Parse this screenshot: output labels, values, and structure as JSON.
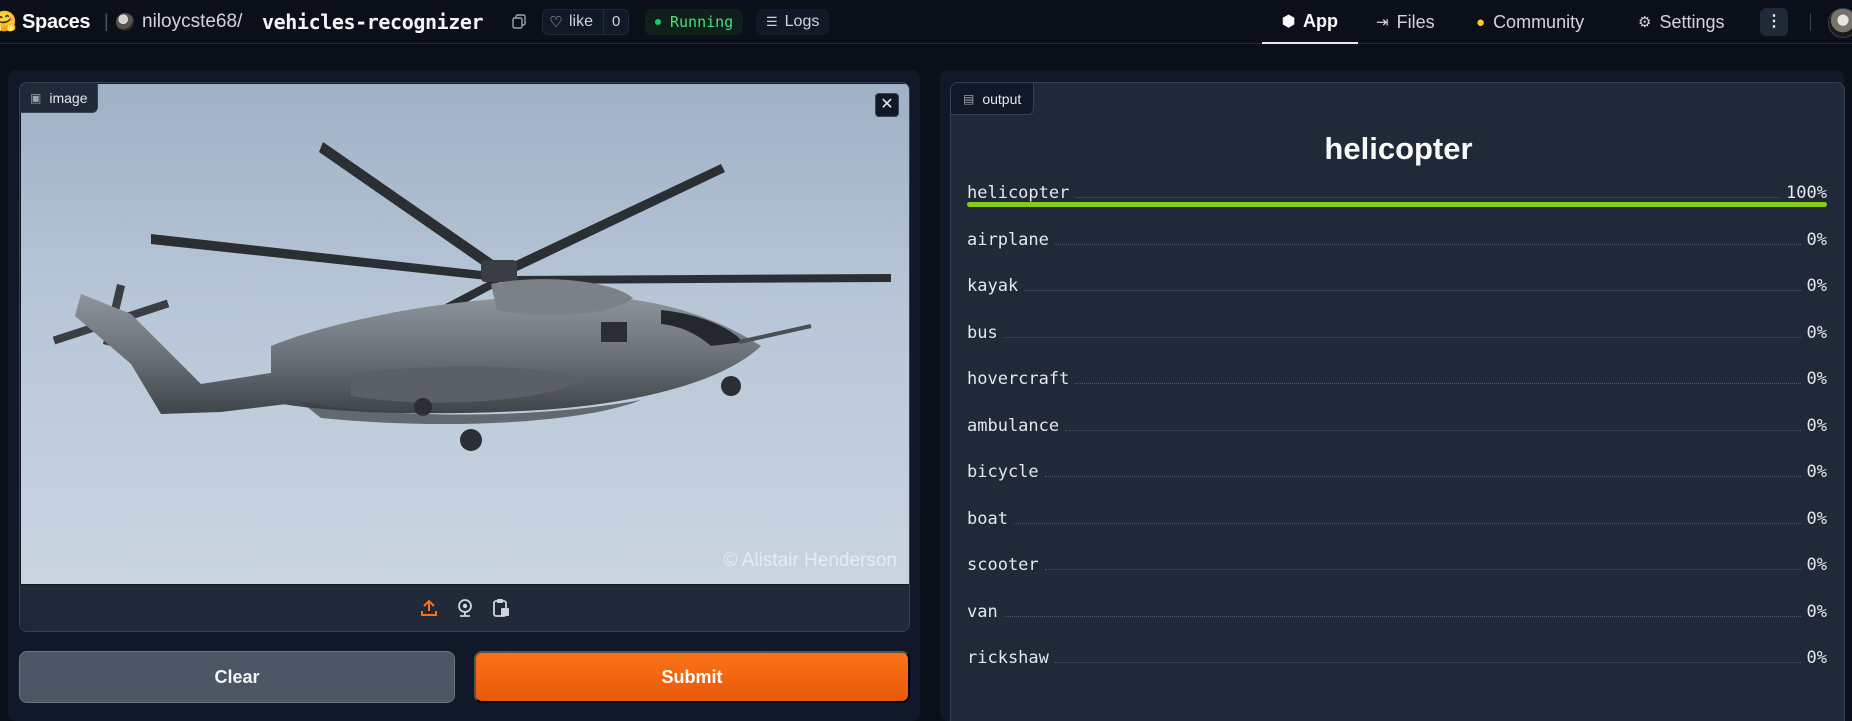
{
  "header": {
    "logo_emoji": "🤗",
    "brand": "Spaces",
    "owner": "niloycste68",
    "slash": "/",
    "repo": "vehicles-recognizer",
    "like_label": "like",
    "like_count": "0",
    "status": "Running",
    "logs_label": "Logs",
    "nav": {
      "app": "App",
      "files": "Files",
      "community": "Community",
      "settings": "Settings"
    }
  },
  "input": {
    "label": "image",
    "watermark": "© Alistair Henderson",
    "clear_label": "Clear",
    "submit_label": "Submit"
  },
  "output": {
    "label": "output",
    "top_prediction": "helicopter",
    "top_fraction": 1.0,
    "predictions": [
      {
        "name": "helicopter",
        "pct": "100%"
      },
      {
        "name": "airplane",
        "pct": "0%"
      },
      {
        "name": "kayak",
        "pct": "0%"
      },
      {
        "name": "bus",
        "pct": "0%"
      },
      {
        "name": "hovercraft",
        "pct": "0%"
      },
      {
        "name": "ambulance",
        "pct": "0%"
      },
      {
        "name": "bicycle",
        "pct": "0%"
      },
      {
        "name": "boat",
        "pct": "0%"
      },
      {
        "name": "scooter",
        "pct": "0%"
      },
      {
        "name": "van",
        "pct": "0%"
      },
      {
        "name": "rickshaw",
        "pct": "0%"
      }
    ]
  },
  "colors": {
    "accent": "#f97316",
    "bar": "#84cc16",
    "running": "#22c55e"
  }
}
